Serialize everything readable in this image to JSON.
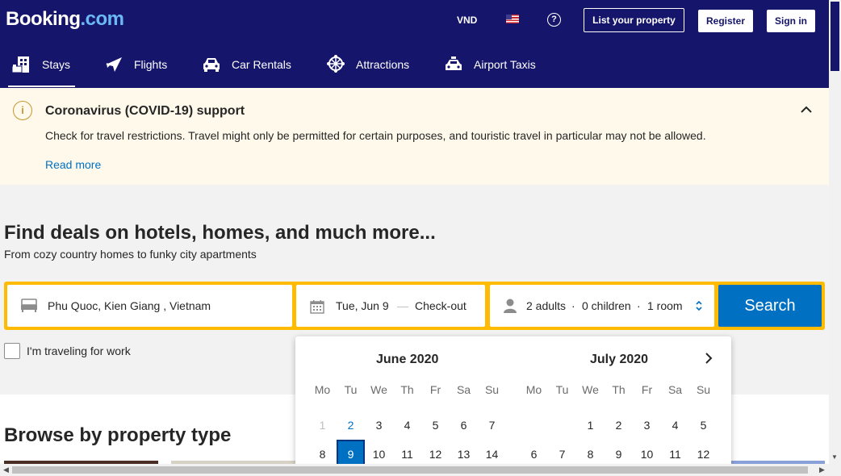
{
  "header": {
    "logo_main": "Booking",
    "logo_suffix": ".com",
    "currency": "VND",
    "help_glyph": "?",
    "list_property": "List your property",
    "register": "Register",
    "sign_in": "Sign in",
    "bg_color": "#15156b"
  },
  "nav": {
    "items": [
      {
        "label": "Stays",
        "icon": "bed-building-icon",
        "active": true
      },
      {
        "label": "Flights",
        "icon": "airplane-icon"
      },
      {
        "label": "Car Rentals",
        "icon": "car-icon"
      },
      {
        "label": "Attractions",
        "icon": "ferris-wheel-icon"
      },
      {
        "label": "Airport Taxis",
        "icon": "taxi-icon"
      }
    ]
  },
  "banner": {
    "title": "Coronavirus (COVID-19) support",
    "text": "Check for travel restrictions. Travel might only be permitted for certain purposes, and touristic travel in particular may not be allowed.",
    "link": "Read more",
    "info_glyph": "i"
  },
  "hero": {
    "title": "Find deals on hotels, homes, and much more...",
    "subtitle": "From cozy country homes to funky city apartments"
  },
  "search": {
    "destination": "Phu Quoc, Kien Giang , Vietnam",
    "checkin": "Tue, Jun 9",
    "date_separator": "—",
    "checkout": "Check-out",
    "adults": "2 adults",
    "children": "0 children",
    "rooms": "1 room",
    "dot": "·",
    "button": "Search",
    "accent_color": "#febb02",
    "button_color": "#0071c2"
  },
  "work_travel": {
    "label": "I'm traveling for work",
    "checked": false
  },
  "browse": {
    "title": "Browse by property type"
  },
  "calendar": {
    "weekdays": [
      "Mo",
      "Tu",
      "We",
      "Th",
      "Fr",
      "Sa",
      "Su"
    ],
    "months": [
      {
        "title": "June 2020",
        "rows": [
          [
            "1",
            "2",
            "3",
            "4",
            "5",
            "6",
            "7"
          ],
          [
            "8",
            "9",
            "10",
            "11",
            "12",
            "13",
            "14"
          ]
        ],
        "past": [
          "1"
        ],
        "today": "2",
        "selected": "9"
      },
      {
        "title": "July 2020",
        "rows": [
          [
            "",
            "",
            "1",
            "2",
            "3",
            "4",
            "5"
          ],
          [
            "6",
            "7",
            "8",
            "9",
            "10",
            "11",
            "12"
          ]
        ]
      }
    ]
  }
}
